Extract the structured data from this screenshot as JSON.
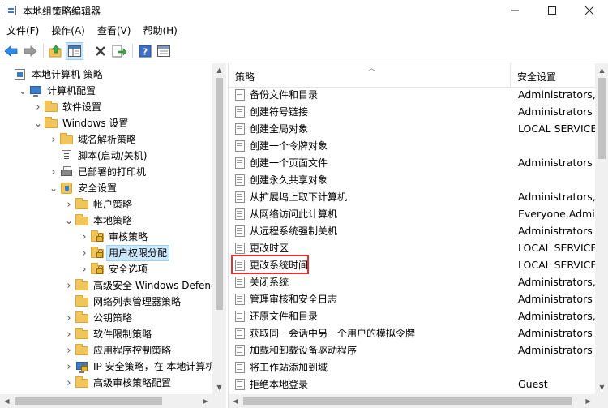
{
  "window": {
    "title": "本地组策略编辑器",
    "controls": [
      "minimize-icon",
      "maximize-icon",
      "close-icon"
    ]
  },
  "menu": [
    "文件(F)",
    "操作(A)",
    "查看(V)",
    "帮助(H)"
  ],
  "toolbar": {
    "icons": [
      "back-arrow-icon",
      "forward-arrow-icon",
      "up-folder-icon",
      "show-hide-tree-icon",
      "delete-icon",
      "export-list-icon",
      "help-icon",
      "properties-icon"
    ]
  },
  "tree": {
    "items": [
      {
        "label": "本地计算机 策略",
        "icon": "policy-doc-icon",
        "level": 0,
        "expander": ""
      },
      {
        "label": "计算机配置",
        "icon": "computer-icon",
        "level": 1,
        "expander": "expanded"
      },
      {
        "label": "软件设置",
        "icon": "folder-icon",
        "level": 2,
        "expander": "collapsed"
      },
      {
        "label": "Windows 设置",
        "icon": "folder-icon",
        "level": 2,
        "expander": "expanded"
      },
      {
        "label": "域名解析策略",
        "icon": "folder-icon",
        "level": 3,
        "expander": "collapsed"
      },
      {
        "label": "脚本(启动/关机)",
        "icon": "script-icon",
        "level": 3,
        "expander": ""
      },
      {
        "label": "已部署的打印机",
        "icon": "printer-icon",
        "level": 3,
        "expander": "collapsed"
      },
      {
        "label": "安全设置",
        "icon": "security-shield-icon",
        "level": 3,
        "expander": "expanded"
      },
      {
        "label": "帐户策略",
        "icon": "folder-icon",
        "level": 4,
        "expander": "collapsed"
      },
      {
        "label": "本地策略",
        "icon": "folder-icon",
        "level": 4,
        "expander": "expanded"
      },
      {
        "label": "审核策略",
        "icon": "locked-folder-icon",
        "level": 5,
        "expander": "collapsed"
      },
      {
        "label": "用户权限分配",
        "icon": "locked-folder-icon",
        "level": 5,
        "expander": "collapsed",
        "selected": true
      },
      {
        "label": "安全选项",
        "icon": "locked-folder-icon",
        "level": 5,
        "expander": "collapsed"
      },
      {
        "label": "高级安全 Windows Defende",
        "icon": "folder-icon",
        "level": 4,
        "expander": "collapsed"
      },
      {
        "label": "网络列表管理器策略",
        "icon": "folder-icon",
        "level": 4,
        "expander": ""
      },
      {
        "label": "公钥策略",
        "icon": "folder-icon",
        "level": 4,
        "expander": "collapsed"
      },
      {
        "label": "软件限制策略",
        "icon": "folder-icon",
        "level": 4,
        "expander": "collapsed"
      },
      {
        "label": "应用程序控制策略",
        "icon": "folder-icon",
        "level": 4,
        "expander": "collapsed"
      },
      {
        "label": "IP 安全策略，在 本地计算机",
        "icon": "ip-security-icon",
        "level": 4,
        "expander": "collapsed"
      },
      {
        "label": "高级审核策略配置",
        "icon": "folder-icon",
        "level": 4,
        "expander": "collapsed"
      }
    ]
  },
  "list": {
    "columns": [
      "策略",
      "安全设置"
    ],
    "rows": [
      {
        "name": "备份文件和目录",
        "setting": "Administrators,E"
      },
      {
        "name": "创建符号链接",
        "setting": "Administrators"
      },
      {
        "name": "创建全局对象",
        "setting": "LOCAL SERVICE,"
      },
      {
        "name": "创建一个令牌对象",
        "setting": ""
      },
      {
        "name": "创建一个页面文件",
        "setting": "Administrators"
      },
      {
        "name": "创建永久共享对象",
        "setting": ""
      },
      {
        "name": "从扩展坞上取下计算机",
        "setting": "Administrators,U"
      },
      {
        "name": "从网络访问此计算机",
        "setting": "Everyone,Admin"
      },
      {
        "name": "从远程系统强制关机",
        "setting": "Administrators"
      },
      {
        "name": "更改时区",
        "setting": "LOCAL SERVICE,"
      },
      {
        "name": "更改系统时间",
        "setting": "LOCAL SERVICE,",
        "highlighted": true
      },
      {
        "name": "关闭系统",
        "setting": "Administrators,U"
      },
      {
        "name": "管理审核和安全日志",
        "setting": "Administrators"
      },
      {
        "name": "还原文件和目录",
        "setting": "Administrators,E"
      },
      {
        "name": "获取同一会话中另一个用户的模拟令牌",
        "setting": "Administrators"
      },
      {
        "name": "加载和卸载设备驱动程序",
        "setting": "Administrators"
      },
      {
        "name": "将工作站添加到域",
        "setting": ""
      },
      {
        "name": "拒绝本地登录",
        "setting": "Guest"
      }
    ]
  },
  "colors": {
    "selection": "#cce8ff",
    "highlight_border": "#e03030",
    "scrollbar": "#f0f0f0"
  }
}
